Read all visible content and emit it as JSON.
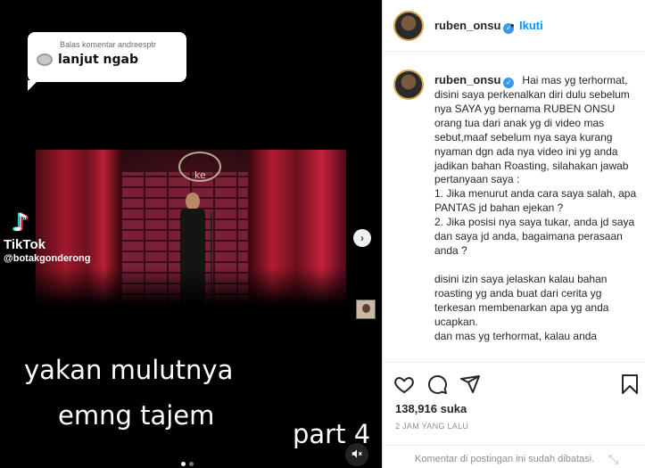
{
  "video": {
    "comment_bubble": {
      "label": "Balas komentar andreesptr",
      "text": "lanjut ngab"
    },
    "watermark": {
      "name": "TikTok",
      "handle": "@botakgonderong"
    },
    "stage_logo": "ke",
    "captions": {
      "line1": "yakan mulutnya",
      "line2": "emng tajem",
      "part": "part 4"
    },
    "carousel": {
      "total": 2,
      "current": 1
    }
  },
  "post": {
    "author": {
      "username": "ruben_onsu",
      "verified": true
    },
    "separator": "•",
    "follow_label": "Ikuti",
    "caption_paragraphs": [
      "Hai mas yg terhormat, disini saya perkenalkan diri dulu sebelum nya SAYA yg bernama RUBEN ONSU orang tua dari anak yg di video mas sebut,maaf sebelum nya saya kurang nyaman dgn ada nya video ini yg anda jadikan bahan Roasting, silahakan jawab pertanyaan saya :",
      "1. Jika menurut anda cara saya salah, apa PANTAS jd bahan ejekan ?",
      "2. Jika posisi nya saya tukar, anda jd saya dan saya jd anda, bagaimana perasaan anda ?",
      "",
      "disini izin saya jelaskan kalau bahan roasting yg anda buat dari cerita yg terkesan membenarkan apa yg anda ucapkan.",
      "dan mas yg terhormat, kalau anda"
    ],
    "likes": "138,916 suka",
    "timestamp": "2 JAM YANG LALU",
    "comments_disabled_note": "Komentar di postingan ini sudah dibatasi.",
    "icons": [
      "heart-icon",
      "comment-icon",
      "share-icon",
      "bookmark-icon"
    ]
  }
}
